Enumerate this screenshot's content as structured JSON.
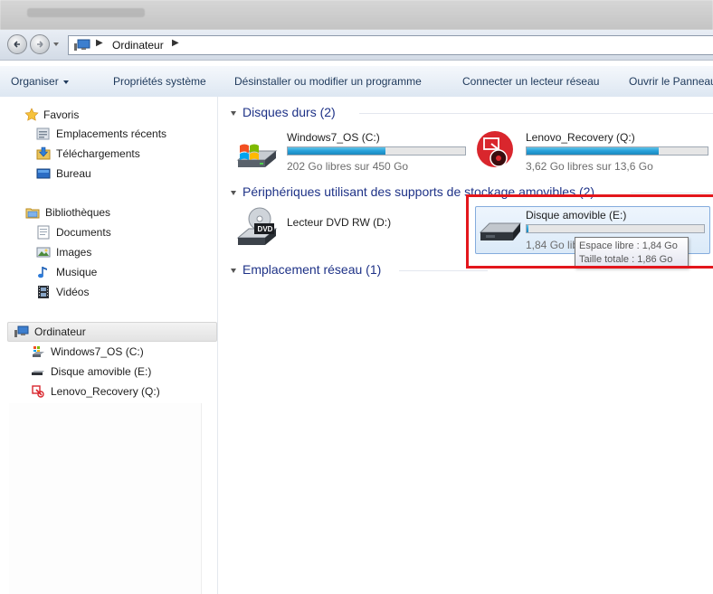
{
  "breadcrumb": {
    "location": "Ordinateur"
  },
  "toolbar": {
    "organize": "Organiser",
    "system_properties": "Propriétés système",
    "uninstall": "Désinstaller ou modifier un programme",
    "map_drive": "Connecter un lecteur réseau",
    "open_panel": "Ouvrir le Panneau"
  },
  "nav": {
    "favorites": {
      "label": "Favoris",
      "items": [
        "Emplacements récents",
        "Téléchargements",
        "Bureau"
      ]
    },
    "libraries": {
      "label": "Bibliothèques",
      "items": [
        "Documents",
        "Images",
        "Musique",
        "Vidéos"
      ]
    },
    "computer": {
      "label": "Ordinateur",
      "items": [
        "Windows7_OS (C:)",
        "Disque amovible (E:)",
        "Lenovo_Recovery (Q:)"
      ]
    }
  },
  "groups": {
    "hard_disks": "Disques durs (2)",
    "removable": "Périphériques utilisant des supports de stockage amovibles (2)",
    "network": "Emplacement réseau (1)"
  },
  "drives": {
    "c": {
      "name": "Windows7_OS (C:)",
      "free_text": "202 Go libres sur 450 Go",
      "used_fraction": 0.55
    },
    "q": {
      "name": "Lenovo_Recovery (Q:)",
      "free_text": "3,62 Go libres sur 13,6 Go",
      "used_fraction": 0.73
    },
    "d": {
      "name": "Lecteur DVD RW (D:)",
      "badge": "DVD"
    },
    "e": {
      "name": "Disque amovible (E:)",
      "free_text": "1,84 Go libres sur 1,86 Go",
      "used_fraction": 0.01
    }
  },
  "tooltip": {
    "free_space": "Espace libre : 1,84 Go",
    "total_size": "Taille totale : 1,86 Go"
  },
  "colors": {
    "bar_fill": "#26a0da",
    "highlight_border": "#e3161c",
    "group_header": "#1e3287"
  }
}
